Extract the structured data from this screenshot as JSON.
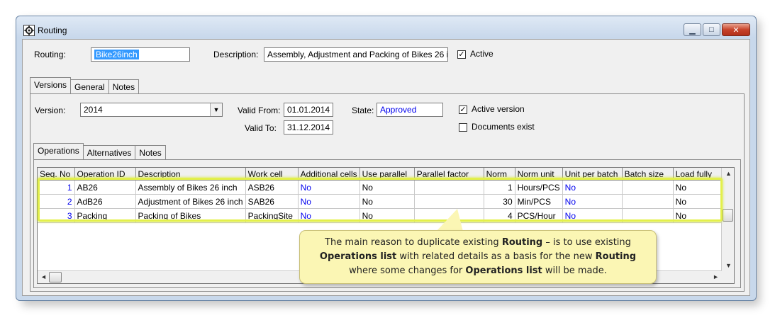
{
  "window": {
    "title": "Routing",
    "icon": "gear-icon",
    "min_glyph": "▁",
    "max_glyph": "□",
    "close_glyph": "✕"
  },
  "header": {
    "routing_label": "Routing:",
    "routing_value": "Bike26inch",
    "description_label": "Description:",
    "description_value": "Assembly, Adjustment and Packing of Bikes 26 i",
    "active_label": "Active",
    "active_checked": true
  },
  "main_tabs": [
    "Versions",
    "General",
    "Notes"
  ],
  "version": {
    "version_label": "Version:",
    "version_value": "2014",
    "valid_from_label": "Valid From:",
    "valid_from_value": "01.01.2014",
    "valid_to_label": "Valid To:",
    "valid_to_value": "31.12.2014",
    "state_label": "State:",
    "state_value": "Approved",
    "active_version_label": "Active version",
    "active_version_checked": true,
    "documents_exist_label": "Documents exist",
    "documents_exist_checked": false
  },
  "sub_tabs": [
    "Operations",
    "Alternatives",
    "Notes"
  ],
  "operations": {
    "columns": [
      "Seq. No",
      "Operation ID",
      "Description",
      "Work cell",
      "Additional cells",
      "Use parallel",
      "Parallel factor",
      "Norm",
      "Norm unit",
      "Unit per batch",
      "Batch size",
      "Load fully"
    ],
    "rows": [
      {
        "seq": "1",
        "op_id": "AB26",
        "desc": "Assembly of Bikes 26 inch",
        "cell": "ASB26",
        "add": "No",
        "par": "No",
        "pf": "",
        "norm": "1",
        "unit": "Hours/PCS",
        "upb": "No",
        "bs": "",
        "lf": "No"
      },
      {
        "seq": "2",
        "op_id": "AdB26",
        "desc": "Adjustment of Bikes 26 inch",
        "cell": "SAB26",
        "add": "No",
        "par": "No",
        "pf": "",
        "norm": "30",
        "unit": "Min/PCS",
        "upb": "No",
        "bs": "",
        "lf": "No"
      },
      {
        "seq": "3",
        "op_id": "Packing",
        "desc": "Packing of Bikes",
        "cell": "PackingSite",
        "add": "No",
        "par": "No",
        "pf": "",
        "norm": "4",
        "unit": "PCS/Hour",
        "upb": "No",
        "bs": "",
        "lf": "No"
      }
    ]
  },
  "callout": {
    "t1": "The main reason to duplicate existing ",
    "b1": "Routing",
    "t2": " – is to use existing",
    "b2": "Operations list",
    "t3": " with related details as a basis for the new ",
    "b3": "Routing",
    "t4": "where some changes for ",
    "b4": "Operations list",
    "t5": " will be made."
  },
  "colors": {
    "highlight": "#e3f04a",
    "callout_bg": "#fbf6b4",
    "link_blue": "#0000ee"
  }
}
